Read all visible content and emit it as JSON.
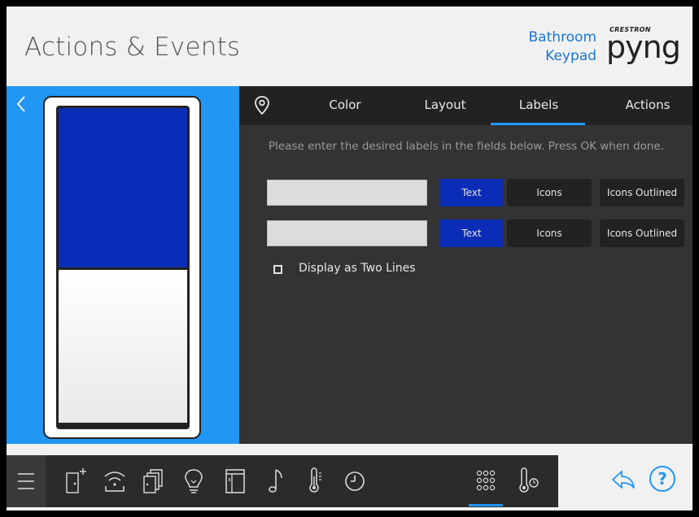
{
  "header": {
    "title": "Actions & Events",
    "device_line1": "Bathroom",
    "device_line2": "Keypad",
    "logo_top": "CRESTRON",
    "logo_main": "pyng"
  },
  "tabs": [
    {
      "label": "Color"
    },
    {
      "label": "Layout"
    },
    {
      "label": "Labels"
    },
    {
      "label": "Actions"
    }
  ],
  "active_tab": "Labels",
  "instructions": "Please enter the desired labels in the fields below. Press OK when done.",
  "label_rows": [
    {
      "value": "",
      "text_btn": "Text",
      "icons_btn": "Icons",
      "outlined_btn": "Icons Outlined"
    },
    {
      "value": "",
      "text_btn": "Text",
      "icons_btn": "Icons",
      "outlined_btn": "Icons Outlined"
    }
  ],
  "two_lines": {
    "label": "Display as Two Lines",
    "checked": false
  },
  "colors": {
    "accent": "#2196f3",
    "button_top": "#0a2cb6",
    "panel_dark": "#333333",
    "header_text": "#555555",
    "device_name": "#1976d2"
  },
  "bottom_nav": {
    "icons": [
      "menu-icon",
      "add-device-icon",
      "wireless-icon",
      "scenes-icon",
      "lightbulb-icon",
      "shade-icon",
      "music-note-icon",
      "thermometer-icon",
      "clock-icon",
      "keypad-grid-icon",
      "thermostat-icon"
    ],
    "active": "keypad-grid-icon"
  }
}
